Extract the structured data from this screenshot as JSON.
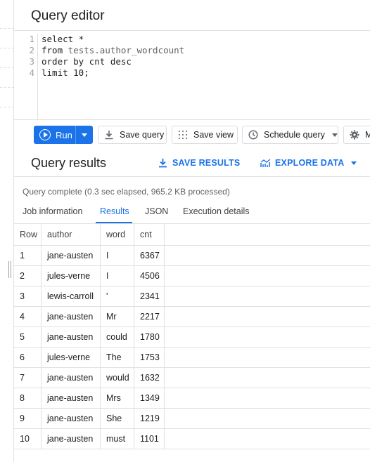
{
  "editor": {
    "title": "Query editor",
    "line_numbers": [
      "1",
      "2",
      "3",
      "4"
    ],
    "code": {
      "line1": "select *",
      "line2_kw": "from ",
      "line2_table": "tests.author_wordcount",
      "line3": "order by cnt desc",
      "line4": "limit 10;"
    }
  },
  "toolbar": {
    "run_label": "Run",
    "save_query_label": "Save query",
    "save_view_label": "Save view",
    "schedule_query_label": "Schedule query",
    "more_label": "M"
  },
  "results": {
    "title": "Query results",
    "save_results_label": "SAVE RESULTS",
    "explore_data_label": "EXPLORE DATA",
    "status": "Query complete (0.3 sec elapsed, 965.2 KB processed)",
    "tabs": [
      "Job information",
      "Results",
      "JSON",
      "Execution details"
    ],
    "active_tab": "Results",
    "columns": [
      "Row",
      "author",
      "word",
      "cnt"
    ],
    "rows": [
      {
        "row": "1",
        "author": "jane-austen",
        "word": "I",
        "cnt": "6367"
      },
      {
        "row": "2",
        "author": "jules-verne",
        "word": "I",
        "cnt": "4506"
      },
      {
        "row": "3",
        "author": "lewis-carroll",
        "word": "'",
        "cnt": "2341"
      },
      {
        "row": "4",
        "author": "jane-austen",
        "word": "Mr",
        "cnt": "2217"
      },
      {
        "row": "5",
        "author": "jane-austen",
        "word": "could",
        "cnt": "1780"
      },
      {
        "row": "6",
        "author": "jules-verne",
        "word": "The",
        "cnt": "1753"
      },
      {
        "row": "7",
        "author": "jane-austen",
        "word": "would",
        "cnt": "1632"
      },
      {
        "row": "8",
        "author": "jane-austen",
        "word": "Mrs",
        "cnt": "1349"
      },
      {
        "row": "9",
        "author": "jane-austen",
        "word": "She",
        "cnt": "1219"
      },
      {
        "row": "10",
        "author": "jane-austen",
        "word": "must",
        "cnt": "1101"
      }
    ]
  },
  "colors": {
    "accent": "#1a73e8",
    "text": "#202124",
    "muted": "#5f6368",
    "border": "#e0e0e0"
  },
  "icons": [
    "play-circle-icon",
    "chevron-down-icon",
    "download-icon",
    "view-grid-icon",
    "clock-icon",
    "gear-icon",
    "explore-chart-icon"
  ]
}
